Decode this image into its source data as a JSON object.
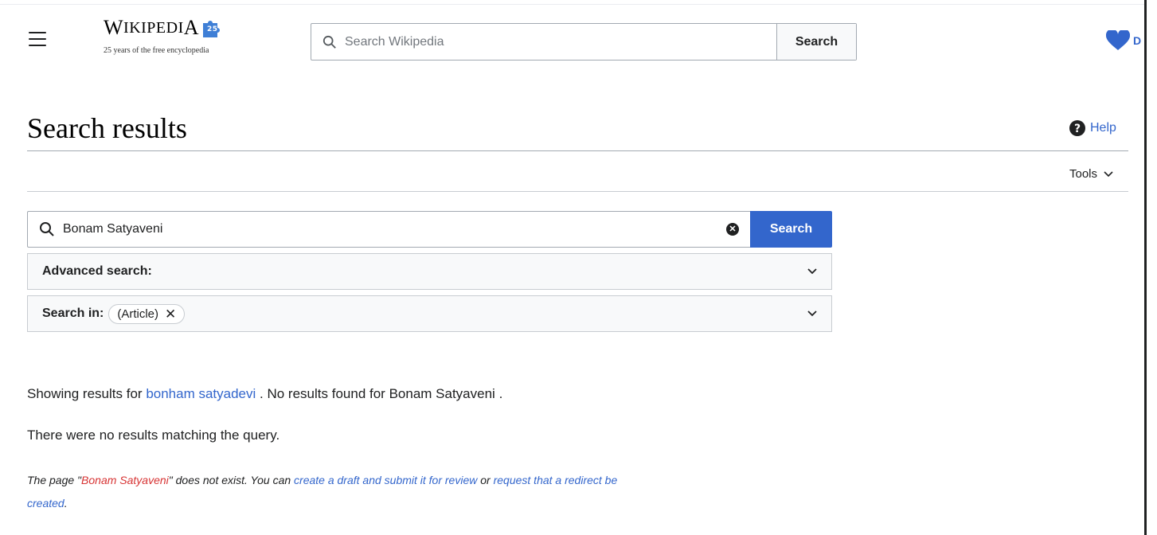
{
  "header": {
    "logo_word_first": "W",
    "logo_word_rest": "IKIPEDI",
    "logo_word_last": "A",
    "logo_tagline": "25 years of the free encyclopedia",
    "search_placeholder": "Search Wikipedia",
    "search_button": "Search",
    "donate_label": "D"
  },
  "page": {
    "title": "Search results",
    "help_label": "Help",
    "tools_label": "Tools"
  },
  "search": {
    "query": "Bonam Satyaveni",
    "button": "Search",
    "advanced_label": "Advanced search:",
    "search_in_label": "Search in:",
    "namespace_chip": "(Article)"
  },
  "results": {
    "showing_prefix": "Showing results for",
    "suggestion": "bonham satyadevi",
    "no_results_prefix": ". No results found for",
    "original_query": "Bonam Satyaveni",
    "no_results_suffix": ".",
    "no_match": "There were no results matching the query.",
    "create_prefix": "The page \"",
    "create_title": "Bonam Satyaveni",
    "create_mid": "\" does not exist. You can ",
    "create_link": "create a draft and submit it for review",
    "create_or": " or ",
    "redirect_link": "request that a redirect be created",
    "create_end": "."
  },
  "colors": {
    "link": "#3366cc",
    "redlink": "#d73333",
    "primary_button": "#3366cc",
    "donate_heart": "#3366cc"
  },
  "icons": {
    "menu": "hamburger-menu-icon",
    "search": "magnifier-icon",
    "clear": "clear-x-icon",
    "help": "question-circle-icon",
    "heart": "heart-icon",
    "chevron": "chevron-down-icon"
  }
}
